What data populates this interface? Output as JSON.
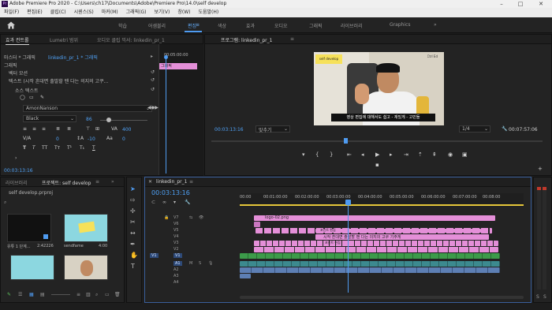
{
  "window": {
    "title": "Adobe Premiere Pro 2020 - C:\\Users\\ch17\\Documents\\Adobe\\Premiere Pro\\14.0\\self develop",
    "icon_label": "Pr"
  },
  "menubar": [
    "파일(F)",
    "편집(E)",
    "클립(C)",
    "시퀀스(S)",
    "마커(M)",
    "그래픽(G)",
    "보기(V)",
    "창(W)",
    "도움말(H)"
  ],
  "workspaces": [
    {
      "label": "학습",
      "active": false
    },
    {
      "label": "어셈블리",
      "active": false
    },
    {
      "label": "편집",
      "active": true
    },
    {
      "label": "색상",
      "active": false
    },
    {
      "label": "효과",
      "active": false
    },
    {
      "label": "오디오",
      "active": false
    },
    {
      "label": "그래픽",
      "active": false
    },
    {
      "label": "라이브러리",
      "active": false
    },
    {
      "label": "Graphics",
      "active": false
    }
  ],
  "effect_controls": {
    "tabs": [
      "효과 컨트롤",
      "Lumetri 범위",
      "오디오 클립 믹서: linkedin_pr_1"
    ],
    "source_row": "마스터 * 그래픽",
    "clip_row": "linkedin_pr_1 * 그래픽",
    "section": "그래픽",
    "items": [
      "벡터 모션",
      "텍스트 (시작 흔대면 출발할 땐 다는 의지의 고쿠...",
      "소스 텍스트"
    ],
    "font": "AmonNanson",
    "style": "Black",
    "size": "86",
    "tracking": "400",
    "kerning_value": "0",
    "leading_value": "-10",
    "baseline_value": "0",
    "timecode": "00:03:13:16",
    "mini_timeline_time": "00:05:00:00",
    "mini_clip_label": "그래픽"
  },
  "program_monitor": {
    "tab": "프로그램: linkedin_pr_1",
    "timecode": "00:03:13:16",
    "fit": "맞추기",
    "quality": "1/4",
    "duration": "00:07:57:06",
    "subtitle": "영상 편집에 대해서도 쉽고 - 재밌게 - 고민들",
    "sticker": "self develop",
    "logo": "Ctrl Ed"
  },
  "project": {
    "tabs": [
      "라이브러리",
      "프로젝트: self develop"
    ],
    "path": "self develop.prproj",
    "items": [
      {
        "name": "유튜 1 단계...",
        "duration": "2:42226"
      },
      {
        "name": "sendfame",
        "duration": "4:00"
      },
      {
        "name": "",
        "duration": ""
      },
      {
        "name": "",
        "duration": ""
      }
    ]
  },
  "timeline": {
    "tab": "linkedin_pr_1",
    "timecode": "00:03:13:16",
    "ruler": [
      "00:00",
      "00:01:00:00",
      "00:02:00:00",
      "00:03:00:00",
      "00:04:00:00",
      "00:05:00:00",
      "00:06:00:00",
      "00:07:00:00",
      "00:08:00"
    ],
    "video_tracks": [
      "V7",
      "V6",
      "V5",
      "V4",
      "V3",
      "V2",
      "V1"
    ],
    "audio_tracks": [
      "A1",
      "A2",
      "A3",
      "A4"
    ],
    "clips": {
      "logo": "logo-02.png",
      "text_a": "포인트 편집",
      "text_b": "포인트 편집",
      "text_c": "시작 흔대면 출발할 땐 다는 의지의 고쿠 기주게"
    },
    "meter_scale": [
      "0",
      "-6",
      "-12",
      "-18",
      "-24",
      "-30",
      "-36",
      "-42",
      "-48",
      "-54"
    ]
  },
  "colors": {
    "accent": "#4f9bf0",
    "pink_clip": "#e48fd8",
    "green_clip": "#3c9b4a",
    "audio_clip": "#3c8a8f"
  }
}
